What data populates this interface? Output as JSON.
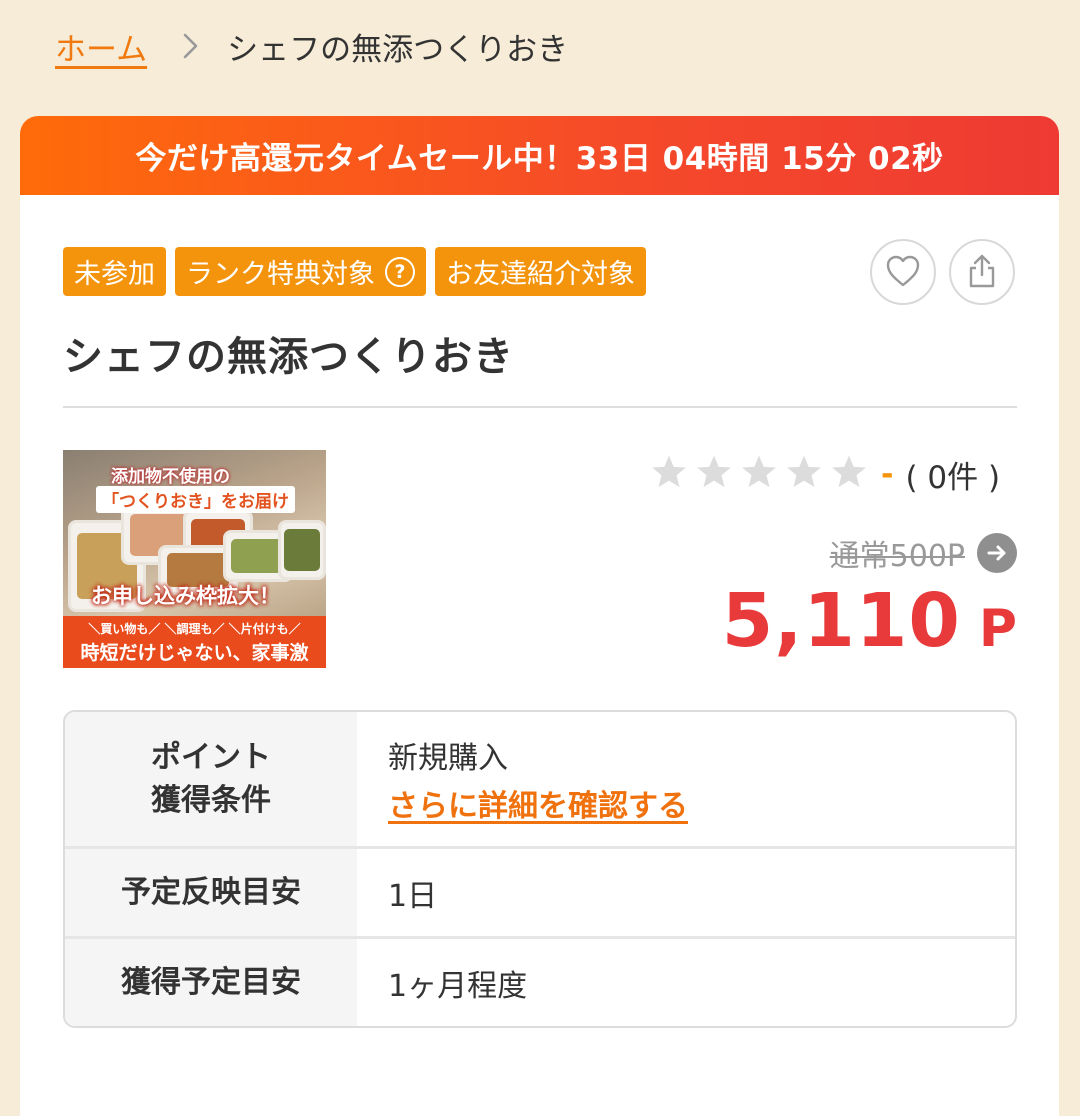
{
  "breadcrumb": {
    "home": "ホーム",
    "current": "シェフの無添つくりおき"
  },
  "sale_banner": "今だけ高還元タイムセール中！33日 04時間 15分 02秒",
  "badges": {
    "status": "未参加",
    "rank": "ランク特典対象",
    "referral": "お友達紹介対象"
  },
  "icons": {
    "favorite": "heart-icon",
    "share": "share-icon",
    "help": "question-icon",
    "breadcrumb_sep": "chevron-right-icon",
    "regular_price_link": "arrow-right-icon"
  },
  "title": "シェフの無添つくりおき",
  "thumbnail": {
    "line1": "添加物不使用の",
    "line2": "「つくりおき」をお届け",
    "line3": "お申し込み枠拡大！",
    "line4": "＼買い物も／ ＼調理も／ ＼片付けも／",
    "line5": "時短だけじゃない、家事激減！"
  },
  "rating": {
    "stars": 0,
    "max": 5,
    "score": "-",
    "count": "( 0件 )"
  },
  "regular_price": "通常500P",
  "price": {
    "value": "5,110",
    "unit": "P"
  },
  "info": {
    "condition_label_1": "ポイント",
    "condition_label_2": "獲得条件",
    "condition_value": "新規購入",
    "detail_link": "さらに詳細を確認する",
    "reflect_label": "予定反映目安",
    "reflect_value": "1日",
    "earn_label": "獲得予定目安",
    "earn_value": "1ヶ月程度"
  },
  "colors": {
    "accent": "#f3940c",
    "link": "#f07a10",
    "price": "#e83a3a",
    "banner_start": "#ff6b0a",
    "banner_end": "#ee3a33",
    "background": "#f6ecd7"
  }
}
